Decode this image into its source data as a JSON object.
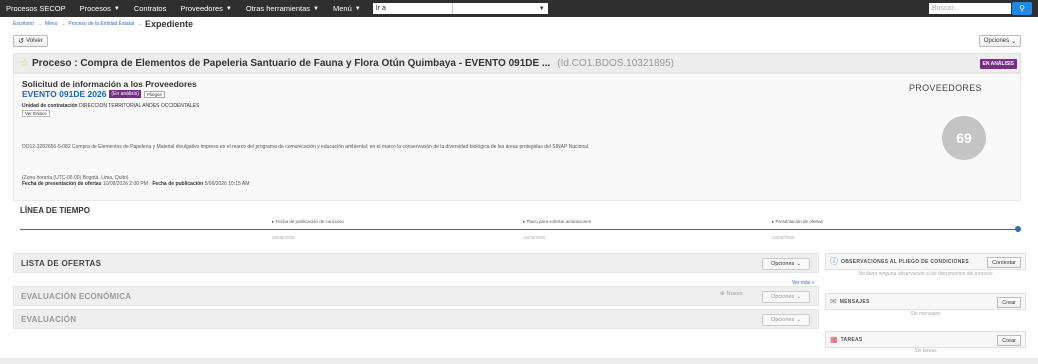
{
  "topbar": {
    "menu": [
      {
        "label": "Procesos SECOP",
        "caret": false
      },
      {
        "label": "Procesos",
        "caret": true
      },
      {
        "label": "Contratos",
        "caret": false
      },
      {
        "label": "Proveedores",
        "caret": true
      },
      {
        "label": "Otras herramientas",
        "caret": true
      },
      {
        "label": "Menú",
        "caret": true
      }
    ],
    "goto": "Ir a",
    "search_placeholder": "Buscar...",
    "search_icon": "search-icon"
  },
  "breadcrumb": {
    "items": [
      "Escritorio",
      "Menú",
      "Proceso de la Entidad Estatal"
    ],
    "current": "Expediente"
  },
  "back_label": "Volver",
  "options_label": "Opciones",
  "process": {
    "title": "Proceso : Compra de Elementos de Papeleria Santuario de Fauna y Flora Otún Quimbaya - EVENTO 091DE ...",
    "id": "(Id.CO1.BDOS.10321895)",
    "status_badge": "EN ANÁLISIS"
  },
  "info": {
    "heading": "Solicitud de información a los Proveedores",
    "event": "EVENTO 091DE 2026",
    "event_tag": "(En análisis)",
    "pliego_tag": "Pliegos",
    "unit_label": "Unidad de contratación",
    "unit_value": "DIRECCION TERRITORIAL ANDES OCCIDENTALES",
    "ver_enlace": "Ver Enlace",
    "description": "DO12-3282656-5-082 Compra de Elementos de Papeleria y Material divulgativo impreso en el marco del programa de comunicación y educación ambiental; en el marco la conservación de la diversidad biológica de las áreas protegidas del SINAP Nacional.",
    "timezone": "(Zona horaria (UTC-05:00) Bogotá, Lima, Quito)",
    "presentation_label": "Fecha de presentación de ofertas",
    "presentation_value": "10/09/2026 2:00 PM",
    "publication_label": "Fecha de publicación",
    "publication_value": "5/06/2026 10:15 AM",
    "providers_title": "PROVEEDORES",
    "providers_count": "69"
  },
  "timeline": {
    "title": "LÍNEA DE TIEMPO",
    "events": [
      {
        "label": "Fecha de publicación de concurso",
        "date": "05/06/2026"
      },
      {
        "label": "Plazo para solicitar aclaraciones",
        "date": "16/03/2026"
      },
      {
        "label": "Presentación de ofertas",
        "date": "10/09/2026"
      }
    ]
  },
  "sections": {
    "ofertas": "LISTA DE OFERTAS",
    "economica": "EVALUACIÓN ECONÓMICA",
    "evaluacion": "EVALUACIÓN",
    "options": "Opciones",
    "nuevo": "Nuevo",
    "ver_mas": "Ver más »"
  },
  "right_panel": {
    "observaciones": {
      "title": "OBSERVACIONES AL PLIEGO DE CONDICIONES",
      "button": "Contestar",
      "note": "No tiene ninguna observación a los documentos del proceso"
    },
    "mensajes": {
      "title": "MENSAJES",
      "button": "Crear",
      "note": "Sin mensajes"
    },
    "tareas": {
      "title": "TAREAS",
      "button": "Crear",
      "note": "Sin tareas"
    }
  },
  "colors": {
    "topbar": "#2f2f2f",
    "accent": "#1565c0",
    "badge": "#7a2b8a",
    "timeline": "#2f6db5"
  }
}
